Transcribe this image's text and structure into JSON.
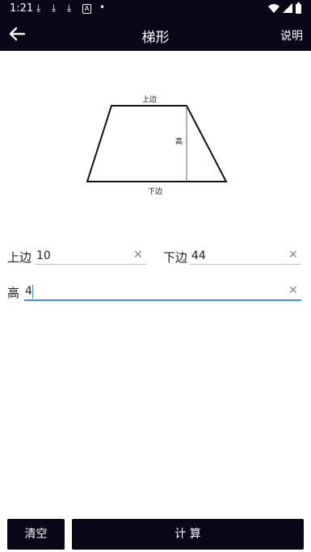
{
  "status_bar": {
    "time": "1:21",
    "app_icon": "A"
  },
  "app_bar": {
    "title": "梯形",
    "help_label": "说明"
  },
  "diagram": {
    "top_label": "上边",
    "height_label": "高",
    "bottom_label": "下边"
  },
  "form": {
    "top_edge": {
      "label": "上边",
      "value": "10"
    },
    "bottom_edge": {
      "label": "下边",
      "value": "44"
    },
    "height": {
      "label": "高",
      "value": "4"
    }
  },
  "buttons": {
    "clear_label": "清空",
    "calculate_label": "计 算"
  },
  "colors": {
    "bar_bg": "#0a0618",
    "focus_underline": "#3d8fe0"
  }
}
